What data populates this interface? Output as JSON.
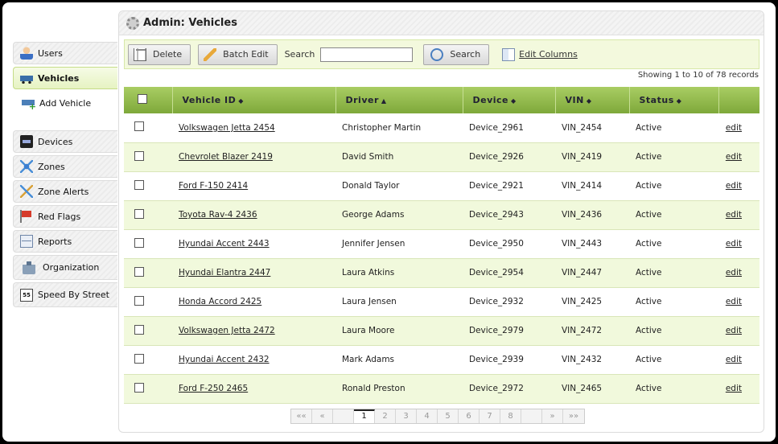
{
  "sidebar": {
    "items": [
      {
        "label": "Users",
        "icon": "users-icon"
      },
      {
        "label": "Vehicles",
        "icon": "car-icon"
      },
      {
        "label": "Add Vehicle",
        "icon": "add-car-icon"
      },
      {
        "label": "Devices",
        "icon": "device-icon"
      },
      {
        "label": "Zones",
        "icon": "zones-icon"
      },
      {
        "label": "Zone Alerts",
        "icon": "zone-alerts-icon"
      },
      {
        "label": "Red Flags",
        "icon": "red-flag-icon"
      },
      {
        "label": "Reports",
        "icon": "mail-icon"
      },
      {
        "label": "Organization",
        "icon": "organization-icon"
      },
      {
        "label": "Speed By Street",
        "icon": "speed-sign-icon"
      }
    ],
    "speed_icon_text": "55"
  },
  "panel": {
    "title": "Admin: Vehicles"
  },
  "toolbar": {
    "delete_label": "Delete",
    "batch_edit_label": "Batch Edit",
    "search_label": "Search",
    "search_value": "",
    "search_button_label": "Search",
    "edit_columns_label": "Edit Columns"
  },
  "showing_text": "Showing 1 to 10 of 78 records",
  "table": {
    "headers": [
      "Vehicle ID",
      "Driver",
      "Device",
      "VIN",
      "Status"
    ],
    "sort_both": "◆",
    "sort_asc": "▲",
    "rows": [
      {
        "vehicle": "Volkswagen  Jetta 2454",
        "driver": "Christopher Martin",
        "device": "Device_2961",
        "vin": "VIN_2454",
        "status": "Active",
        "action": "edit"
      },
      {
        "vehicle": "Chevrolet Blazer 2419",
        "driver": "David Smith",
        "device": "Device_2926",
        "vin": "VIN_2419",
        "status": "Active",
        "action": "edit"
      },
      {
        "vehicle": "Ford F-150 2414",
        "driver": "Donald Taylor",
        "device": "Device_2921",
        "vin": "VIN_2414",
        "status": "Active",
        "action": "edit"
      },
      {
        "vehicle": "Toyota Rav-4 2436",
        "driver": "George Adams",
        "device": "Device_2943",
        "vin": "VIN_2436",
        "status": "Active",
        "action": "edit"
      },
      {
        "vehicle": "Hyundai Accent 2443",
        "driver": "Jennifer Jensen",
        "device": "Device_2950",
        "vin": "VIN_2443",
        "status": "Active",
        "action": "edit"
      },
      {
        "vehicle": "Hyundai Elantra 2447",
        "driver": "Laura Atkins",
        "device": "Device_2954",
        "vin": "VIN_2447",
        "status": "Active",
        "action": "edit"
      },
      {
        "vehicle": "Honda Accord 2425",
        "driver": "Laura Jensen",
        "device": "Device_2932",
        "vin": "VIN_2425",
        "status": "Active",
        "action": "edit"
      },
      {
        "vehicle": "Volkswagen  Jetta 2472",
        "driver": "Laura Moore",
        "device": "Device_2979",
        "vin": "VIN_2472",
        "status": "Active",
        "action": "edit"
      },
      {
        "vehicle": "Hyundai Accent 2432",
        "driver": "Mark Adams",
        "device": "Device_2939",
        "vin": "VIN_2432",
        "status": "Active",
        "action": "edit"
      },
      {
        "vehicle": "Ford F-250 2465",
        "driver": "Ronald Preston",
        "device": "Device_2972",
        "vin": "VIN_2465",
        "status": "Active",
        "action": "edit"
      }
    ]
  },
  "pager": {
    "first": "««",
    "prev": "«",
    "pages": [
      "1",
      "2",
      "3",
      "4",
      "5",
      "6",
      "7",
      "8"
    ],
    "current": "1",
    "next": "»",
    "last": "»»"
  },
  "colors": {
    "header_green": "#8fb84a",
    "row_alt": "#f1f9dc",
    "toolbar_bg": "#f3f9dd"
  }
}
